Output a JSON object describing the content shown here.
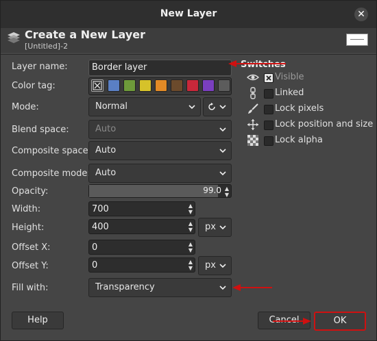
{
  "window": {
    "title": "New Layer",
    "close_icon": "close-icon"
  },
  "header": {
    "title": "Create a New Layer",
    "subtitle": "[Untitled]-2"
  },
  "form": {
    "layer_name": {
      "label": "Layer name:",
      "value": "Border layer"
    },
    "color_tag": {
      "label": "Color tag:",
      "colors": [
        "#5a7fc4",
        "#6e9a3a",
        "#d6c22a",
        "#e28a26",
        "#6b4a2c",
        "#c8283a",
        "#7a3fc0",
        "#5c5c5c"
      ]
    },
    "mode": {
      "label": "Mode:",
      "value": "Normal"
    },
    "blend_space": {
      "label": "Blend space:",
      "value": "Auto"
    },
    "composite_space": {
      "label": "Composite space:",
      "value": "Auto"
    },
    "composite_mode": {
      "label": "Composite mode:",
      "value": "Auto"
    },
    "opacity": {
      "label": "Opacity:",
      "value": "99.0",
      "fraction": 0.99
    },
    "width": {
      "label": "Width:",
      "value": "700"
    },
    "height": {
      "label": "Height:",
      "value": "400",
      "unit": "px"
    },
    "offset_x": {
      "label": "Offset X:",
      "value": "0"
    },
    "offset_y": {
      "label": "Offset Y:",
      "value": "0",
      "unit": "px"
    },
    "fill_with": {
      "label": "Fill with:",
      "value": "Transparency"
    }
  },
  "switches": {
    "title": "Switches",
    "items": [
      {
        "label": "Visible",
        "icon": "eye-icon",
        "checked": true
      },
      {
        "label": "Linked",
        "icon": "chain-icon",
        "checked": false
      },
      {
        "label": "Lock pixels",
        "icon": "brush-icon",
        "checked": false
      },
      {
        "label": "Lock position and size",
        "icon": "move-icon",
        "checked": false
      },
      {
        "label": "Lock alpha",
        "icon": "checkerboard-icon",
        "checked": false
      }
    ]
  },
  "buttons": {
    "help": "Help",
    "cancel": "Cancel",
    "ok": "OK"
  },
  "colors": {
    "annotation_red": "#d01010"
  }
}
